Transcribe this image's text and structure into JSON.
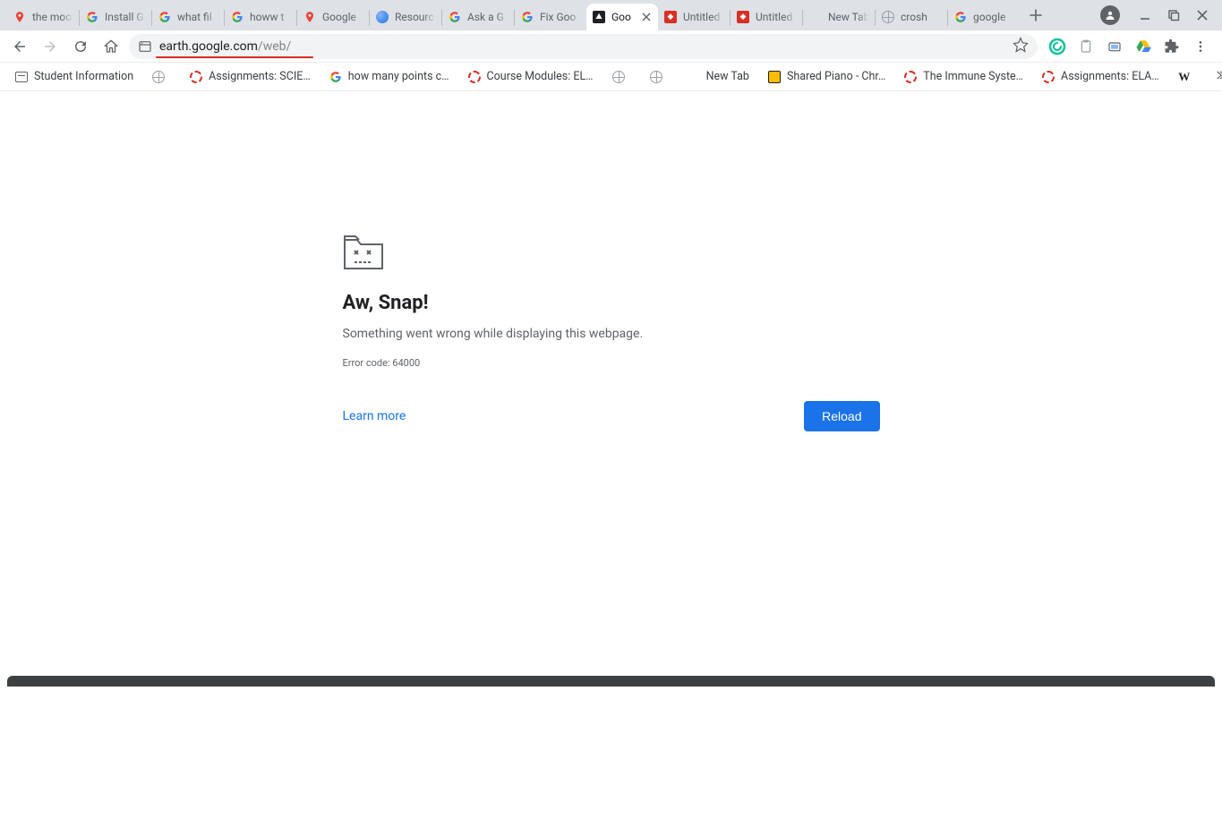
{
  "tabs": [
    {
      "title": "the moo",
      "icon": "maps-pin"
    },
    {
      "title": "Install G",
      "icon": "google-g"
    },
    {
      "title": "what fil",
      "icon": "google-g"
    },
    {
      "title": "howw t",
      "icon": "google-g"
    },
    {
      "title": "Google",
      "icon": "maps-pin"
    },
    {
      "title": "Resourc",
      "icon": "blue-sphere"
    },
    {
      "title": "Ask a G",
      "icon": "google-g"
    },
    {
      "title": "Fix Goo",
      "icon": "google-g"
    },
    {
      "title": "Goo",
      "icon": "dark-box",
      "active": true,
      "closeable": true
    },
    {
      "title": "Untitled",
      "icon": "red-box"
    },
    {
      "title": "Untitled",
      "icon": "red-box"
    },
    {
      "title": "New Tab",
      "icon": "none"
    },
    {
      "title": "crosh",
      "icon": "globe-gray"
    },
    {
      "title": "google",
      "icon": "google-g"
    }
  ],
  "toolbar": {
    "url_host": "earth.google.com",
    "url_path": "/web/"
  },
  "extensions": [
    "grammarly",
    "clipboard",
    "screenshot",
    "drive",
    "puzzle",
    "menu"
  ],
  "bookmarks": [
    {
      "label": "Student Information",
      "icon": "bookmark"
    },
    {
      "label": "",
      "icon": "globe-gray"
    },
    {
      "label": "Assignments: SCIE…",
      "icon": "canvas"
    },
    {
      "label": "how many points c…",
      "icon": "google-g"
    },
    {
      "label": "Course Modules: EL…",
      "icon": "canvas"
    },
    {
      "label": "",
      "icon": "globe-gray"
    },
    {
      "label": "",
      "icon": "globe-gray"
    },
    {
      "label": "New Tab",
      "icon": "none"
    },
    {
      "label": "Shared Piano - Chr…",
      "icon": "yellow-box"
    },
    {
      "label": "The Immune Syste…",
      "icon": "canvas"
    },
    {
      "label": "Assignments: ELA…",
      "icon": "canvas"
    },
    {
      "label": "",
      "icon": "wikipedia"
    }
  ],
  "error": {
    "title": "Aw, Snap!",
    "message": "Something went wrong while displaying this webpage.",
    "code": "Error code: 64000",
    "learn_more": "Learn more",
    "reload": "Reload"
  }
}
